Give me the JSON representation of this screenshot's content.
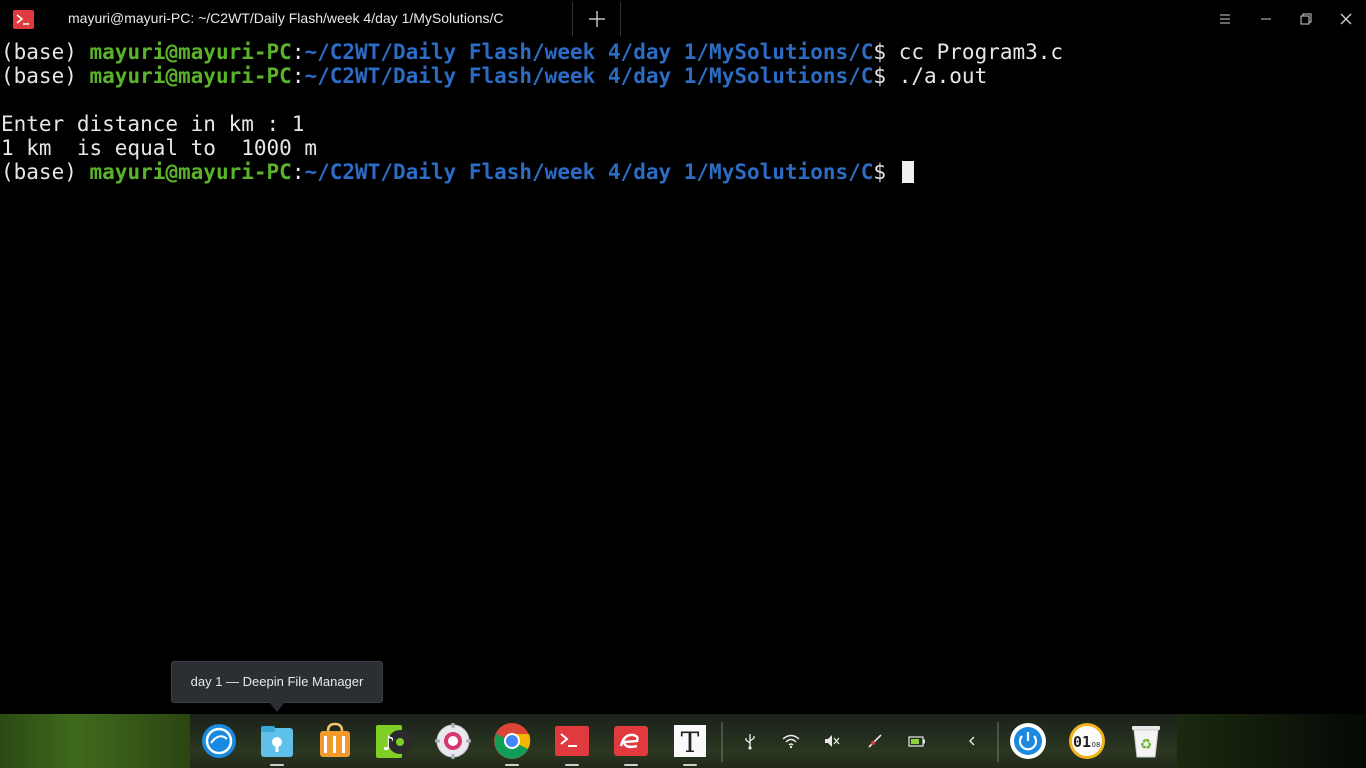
{
  "window": {
    "tab_title": "mayuri@mayuri-PC: ~/C2WT/Daily Flash/week 4/day 1/MySolutions/C"
  },
  "terminal": {
    "lines": [
      {
        "env": "(base) ",
        "user": "mayuri@mayuri-PC",
        "colon": ":",
        "path": "~/C2WT/Daily Flash/week 4/day 1/MySolutions/C",
        "prompt": "$ ",
        "cmd": "cc Program3.c"
      },
      {
        "env": "(base) ",
        "user": "mayuri@mayuri-PC",
        "colon": ":",
        "path": "~/C2WT/Daily Flash/week 4/day 1/MySolutions/C",
        "prompt": "$ ",
        "cmd": "./a.out"
      },
      {
        "text": ""
      },
      {
        "text": "Enter distance in km : 1"
      },
      {
        "text": "1 km  is equal to  1000 m"
      },
      {
        "env": "(base) ",
        "user": "mayuri@mayuri-PC",
        "colon": ":",
        "path": "~/C2WT/Daily Flash/week 4/day 1/MySolutions/C",
        "prompt": "$ ",
        "cmd": ""
      }
    ]
  },
  "tooltip": {
    "text": "day 1 — Deepin File Manager"
  },
  "dock": {
    "apps": [
      "launcher-icon",
      "file-manager-icon",
      "app-store-icon",
      "music-icon",
      "settings-icon",
      "chrome-icon",
      "terminal-icon",
      "wps-icon",
      "text-editor-icon"
    ],
    "tray": [
      "usb-icon",
      "wifi-icon",
      "volume-muted-icon",
      "pen-icon",
      "battery-icon",
      "expand-icon"
    ],
    "plugins": [
      "power-icon",
      "clock-icon",
      "trash-icon"
    ],
    "clock_digits": "01",
    "clock_small": "08",
    "editor_letter": "T",
    "colors": {
      "accent_green": "#5bb32b",
      "accent_blue": "#2c6cc4",
      "terminal_red": "#e0393e"
    }
  }
}
